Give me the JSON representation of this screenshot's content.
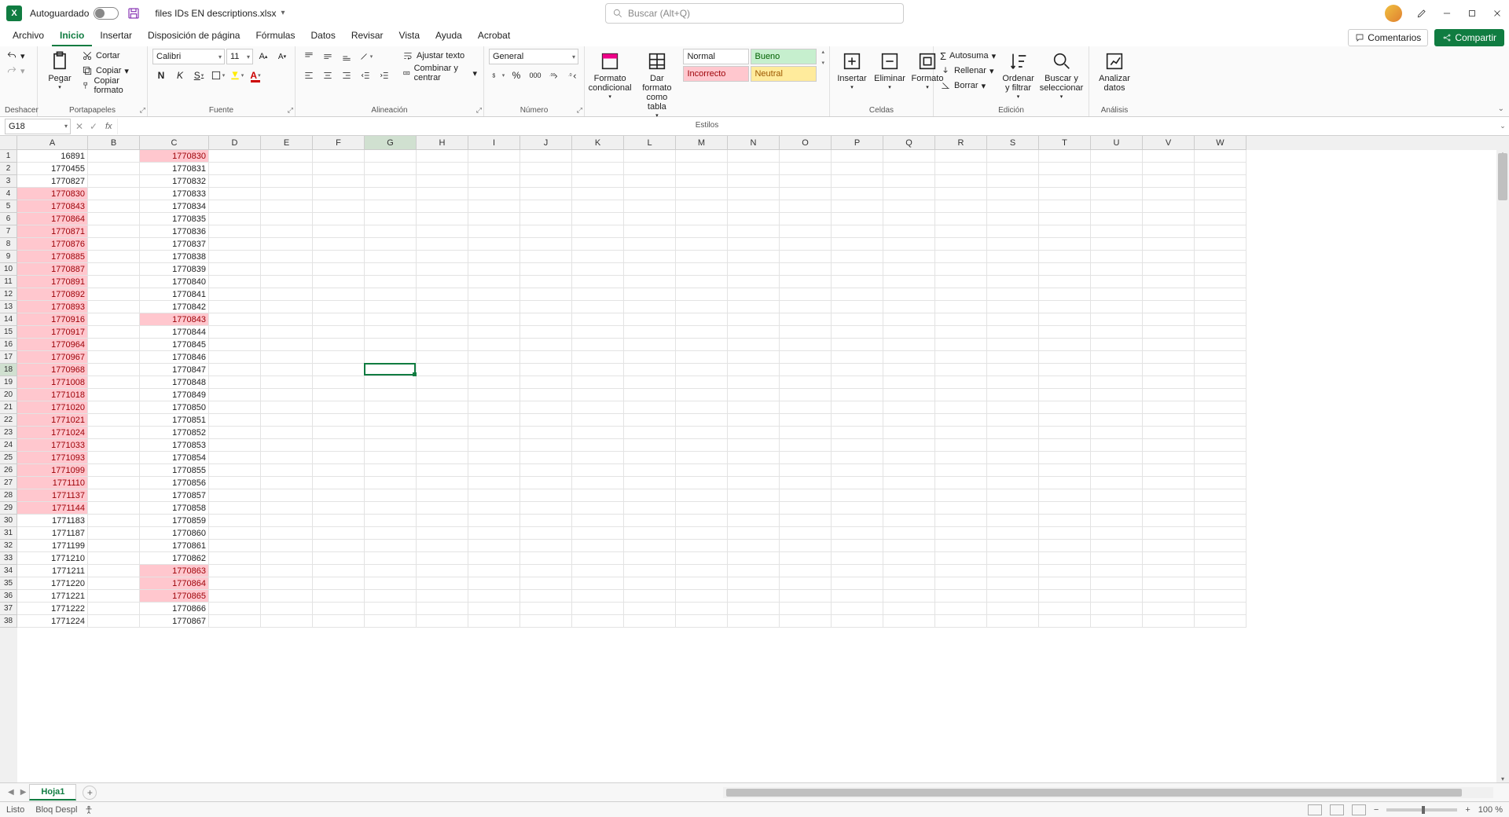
{
  "titlebar": {
    "autosave_label": "Autoguardado",
    "filename": "files IDs EN descriptions.xlsx",
    "search_placeholder": "Buscar (Alt+Q)"
  },
  "tabs": {
    "items": [
      "Archivo",
      "Inicio",
      "Insertar",
      "Disposición de página",
      "Fórmulas",
      "Datos",
      "Revisar",
      "Vista",
      "Ayuda",
      "Acrobat"
    ],
    "active": 1,
    "comments": "Comentarios",
    "share": "Compartir"
  },
  "ribbon": {
    "undo_group": "Deshacer",
    "clipboard": {
      "paste": "Pegar",
      "cut": "Cortar",
      "copy": "Copiar",
      "format_painter": "Copiar formato",
      "label": "Portapapeles"
    },
    "font": {
      "name": "Calibri",
      "size": "11",
      "bold": "N",
      "italic": "K",
      "underline": "S",
      "label": "Fuente"
    },
    "alignment": {
      "wrap": "Ajustar texto",
      "merge": "Combinar y centrar",
      "label": "Alineación"
    },
    "number": {
      "format": "General",
      "label": "Número"
    },
    "styles": {
      "conditional": "Formato condicional",
      "table": "Dar formato como tabla",
      "normal": "Normal",
      "bueno": "Bueno",
      "incorrecto": "Incorrecto",
      "neutral": "Neutral",
      "label": "Estilos"
    },
    "cells": {
      "insert": "Insertar",
      "delete": "Eliminar",
      "format": "Formato",
      "label": "Celdas"
    },
    "editing": {
      "autosum": "Autosuma",
      "fill": "Rellenar",
      "clear": "Borrar",
      "sort": "Ordenar y filtrar",
      "find": "Buscar y seleccionar",
      "label": "Edición"
    },
    "analysis": {
      "analyze": "Analizar datos",
      "label": "Análisis"
    }
  },
  "namebox": "G18",
  "formula": "",
  "columns": [
    "A",
    "B",
    "C",
    "D",
    "E",
    "F",
    "G",
    "H",
    "I",
    "J",
    "K",
    "L",
    "M",
    "N",
    "O",
    "P",
    "Q",
    "R",
    "S",
    "T",
    "U",
    "V",
    "W"
  ],
  "col_widths": {
    "A": 90,
    "B": 66,
    "C": 88,
    "default": 66
  },
  "selected_cell": {
    "col": "G",
    "row": 18
  },
  "rows_visible": 38,
  "data_A": [
    {
      "v": "16891",
      "hl": false
    },
    {
      "v": "1770455",
      "hl": false
    },
    {
      "v": "1770827",
      "hl": false
    },
    {
      "v": "1770830",
      "hl": true
    },
    {
      "v": "1770843",
      "hl": true
    },
    {
      "v": "1770864",
      "hl": true
    },
    {
      "v": "1770871",
      "hl": true
    },
    {
      "v": "1770876",
      "hl": true
    },
    {
      "v": "1770885",
      "hl": true
    },
    {
      "v": "1770887",
      "hl": true
    },
    {
      "v": "1770891",
      "hl": true
    },
    {
      "v": "1770892",
      "hl": true
    },
    {
      "v": "1770893",
      "hl": true
    },
    {
      "v": "1770916",
      "hl": true
    },
    {
      "v": "1770917",
      "hl": true
    },
    {
      "v": "1770964",
      "hl": true
    },
    {
      "v": "1770967",
      "hl": true
    },
    {
      "v": "1770968",
      "hl": true
    },
    {
      "v": "1771008",
      "hl": true
    },
    {
      "v": "1771018",
      "hl": true
    },
    {
      "v": "1771020",
      "hl": true
    },
    {
      "v": "1771021",
      "hl": true
    },
    {
      "v": "1771024",
      "hl": true
    },
    {
      "v": "1771033",
      "hl": true
    },
    {
      "v": "1771093",
      "hl": true
    },
    {
      "v": "1771099",
      "hl": true
    },
    {
      "v": "1771110",
      "hl": true
    },
    {
      "v": "1771137",
      "hl": true
    },
    {
      "v": "1771144",
      "hl": true
    },
    {
      "v": "1771183",
      "hl": false
    },
    {
      "v": "1771187",
      "hl": false
    },
    {
      "v": "1771199",
      "hl": false
    },
    {
      "v": "1771210",
      "hl": false
    },
    {
      "v": "1771211",
      "hl": false
    },
    {
      "v": "1771220",
      "hl": false
    },
    {
      "v": "1771221",
      "hl": false
    },
    {
      "v": "1771222",
      "hl": false
    },
    {
      "v": "1771224",
      "hl": false
    }
  ],
  "data_C": [
    {
      "v": "1770830",
      "hl": true
    },
    {
      "v": "1770831",
      "hl": false
    },
    {
      "v": "1770832",
      "hl": false
    },
    {
      "v": "1770833",
      "hl": false
    },
    {
      "v": "1770834",
      "hl": false
    },
    {
      "v": "1770835",
      "hl": false
    },
    {
      "v": "1770836",
      "hl": false
    },
    {
      "v": "1770837",
      "hl": false
    },
    {
      "v": "1770838",
      "hl": false
    },
    {
      "v": "1770839",
      "hl": false
    },
    {
      "v": "1770840",
      "hl": false
    },
    {
      "v": "1770841",
      "hl": false
    },
    {
      "v": "1770842",
      "hl": false
    },
    {
      "v": "1770843",
      "hl": true
    },
    {
      "v": "1770844",
      "hl": false
    },
    {
      "v": "1770845",
      "hl": false
    },
    {
      "v": "1770846",
      "hl": false
    },
    {
      "v": "1770847",
      "hl": false
    },
    {
      "v": "1770848",
      "hl": false
    },
    {
      "v": "1770849",
      "hl": false
    },
    {
      "v": "1770850",
      "hl": false
    },
    {
      "v": "1770851",
      "hl": false
    },
    {
      "v": "1770852",
      "hl": false
    },
    {
      "v": "1770853",
      "hl": false
    },
    {
      "v": "1770854",
      "hl": false
    },
    {
      "v": "1770855",
      "hl": false
    },
    {
      "v": "1770856",
      "hl": false
    },
    {
      "v": "1770857",
      "hl": false
    },
    {
      "v": "1770858",
      "hl": false
    },
    {
      "v": "1770859",
      "hl": false
    },
    {
      "v": "1770860",
      "hl": false
    },
    {
      "v": "1770861",
      "hl": false
    },
    {
      "v": "1770862",
      "hl": false
    },
    {
      "v": "1770863",
      "hl": true
    },
    {
      "v": "1770864",
      "hl": true
    },
    {
      "v": "1770865",
      "hl": true
    },
    {
      "v": "1770866",
      "hl": false
    },
    {
      "v": "1770867",
      "hl": false
    }
  ],
  "sheet": {
    "name": "Hoja1"
  },
  "status": {
    "ready": "Listo",
    "scroll_lock": "Bloq Despl",
    "zoom": "100 %"
  }
}
